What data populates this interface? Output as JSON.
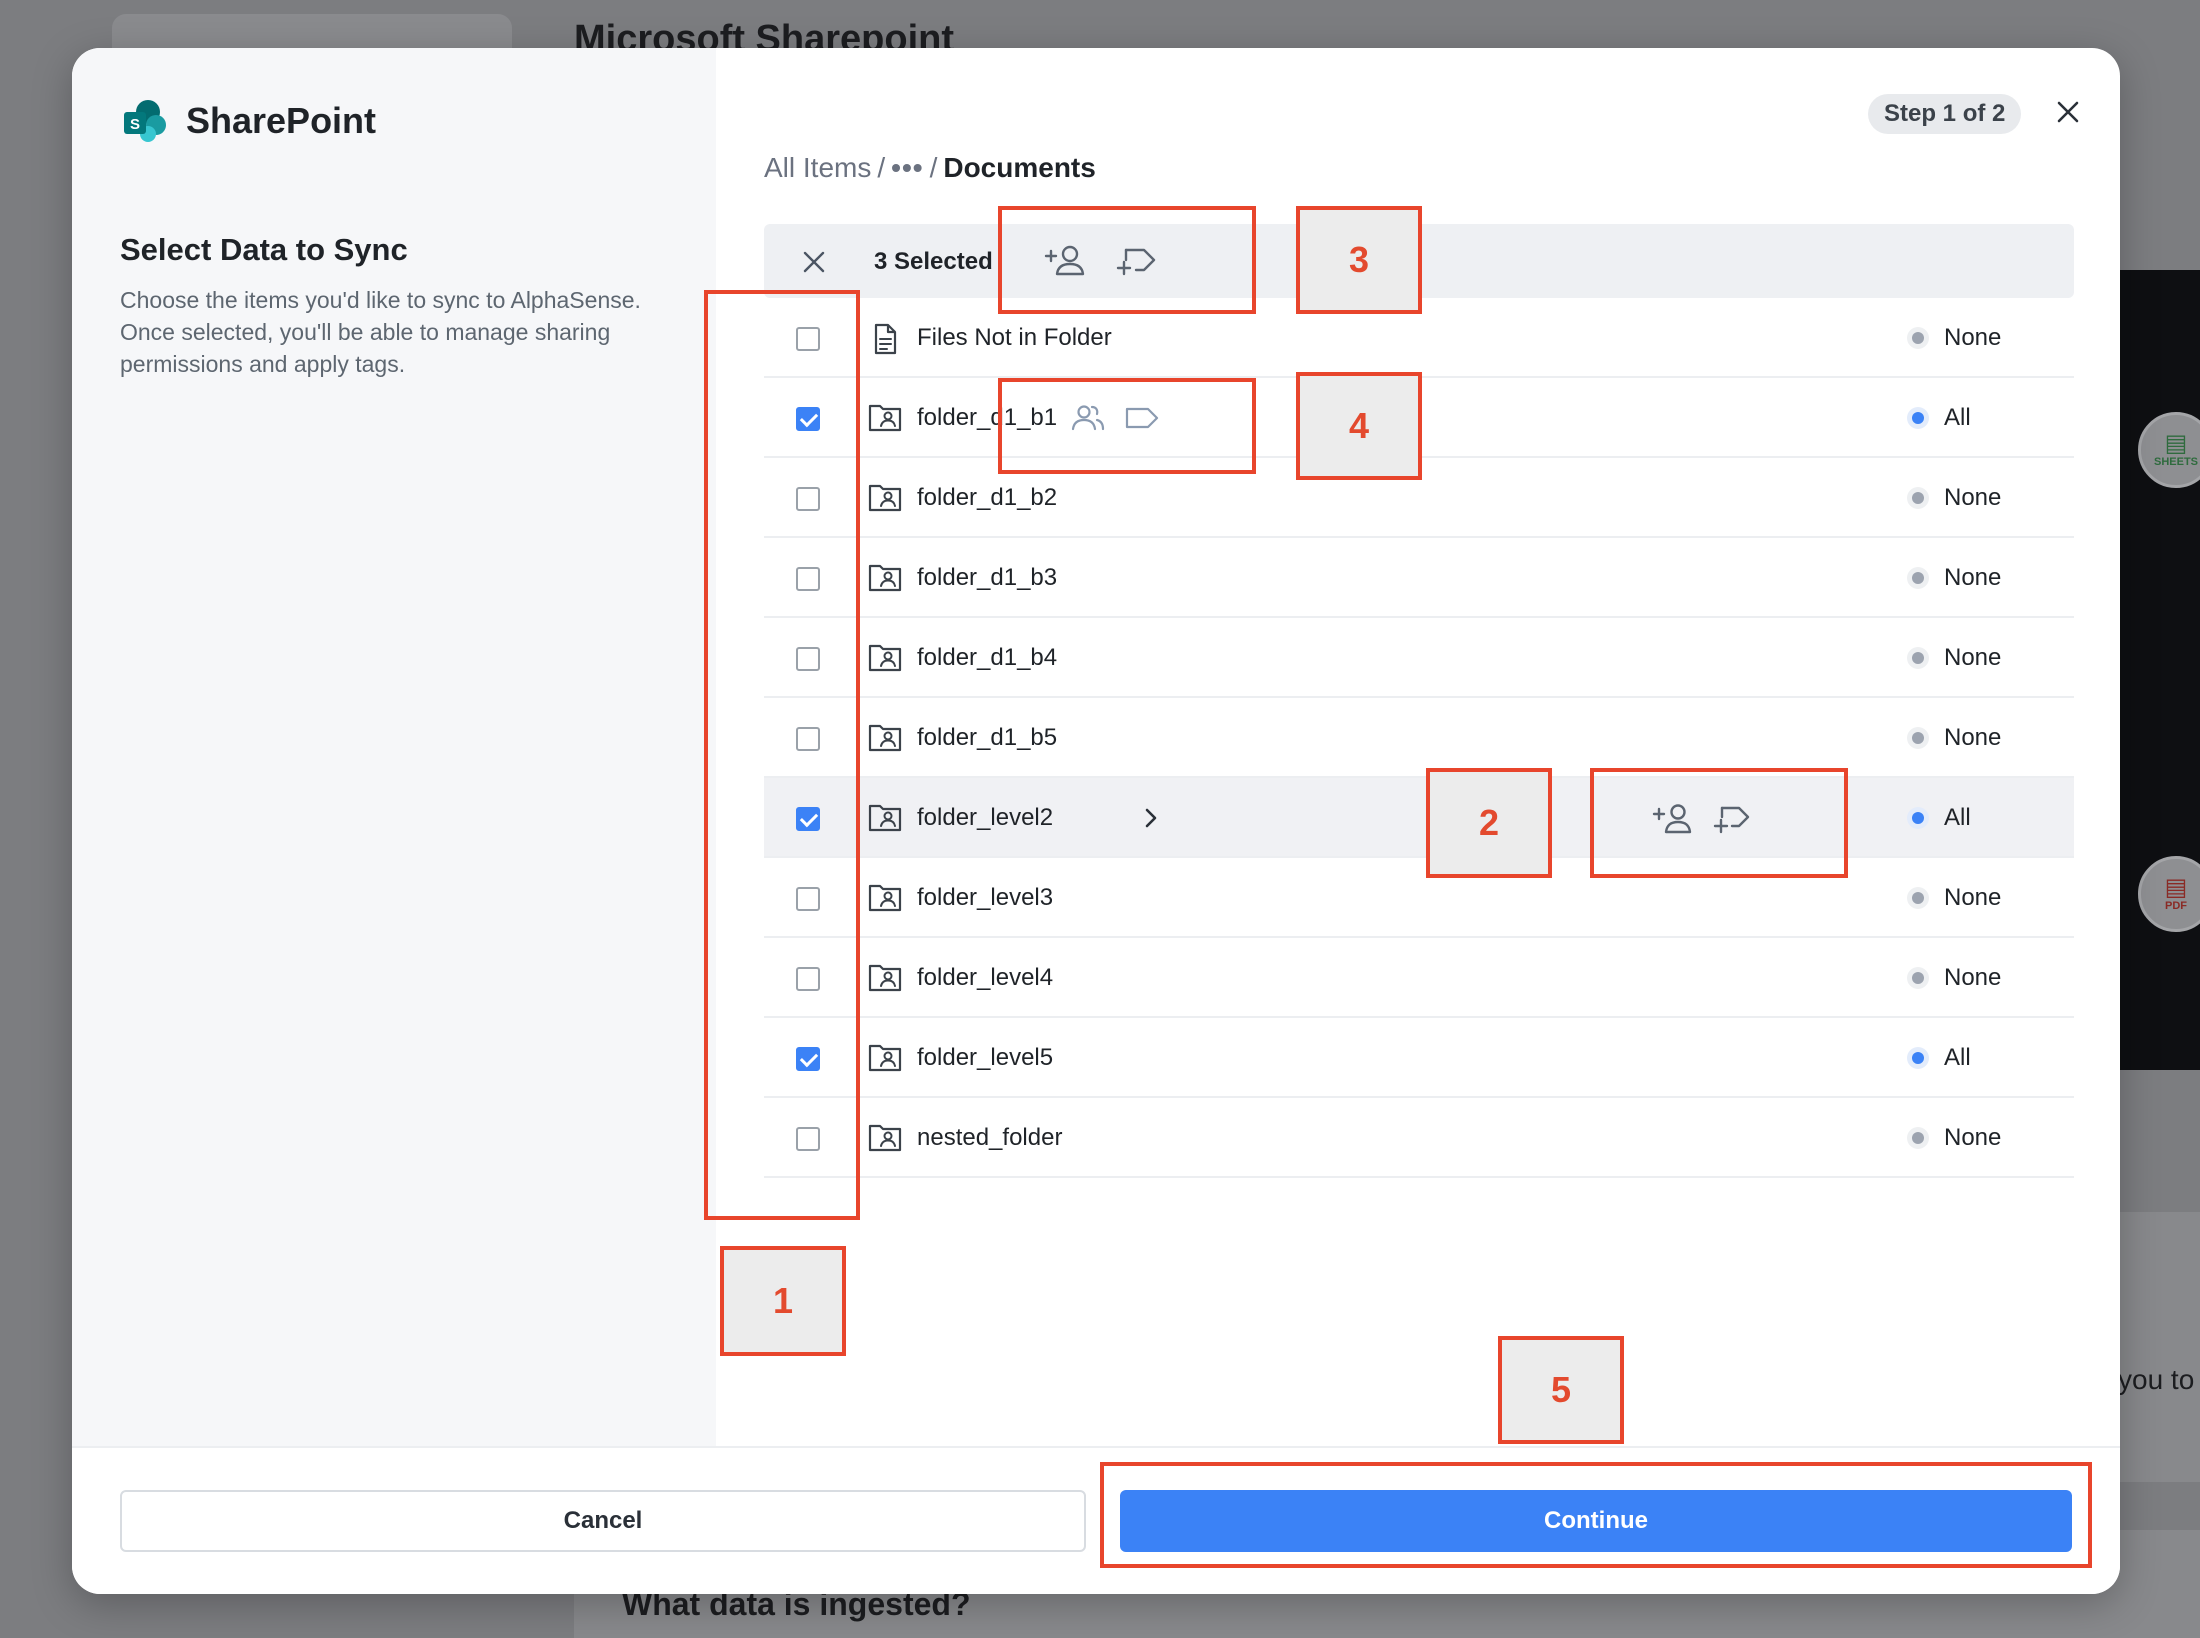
{
  "background": {
    "page_title": "Microsoft Sharepoint",
    "side_text": "you to",
    "bottom_heading": "What data is ingested?",
    "sheets_label": "SHEETS",
    "pdf_label": "PDF"
  },
  "modal": {
    "brand": {
      "name": "SharePoint",
      "icon": "sharepoint-logo"
    },
    "left": {
      "title": "Select Data to Sync",
      "description": "Choose the items you'd like to sync to AlphaSense. Once selected, you'll be able to manage sharing permissions and apply tags."
    },
    "breadcrumb": {
      "root": "All Items",
      "separator": "/",
      "ellipsis": "•••",
      "current": "Documents"
    },
    "step_badge": "Step 1 of 2",
    "selection_bar": {
      "count_label": "3 Selected",
      "icons": [
        "close-icon",
        "add-person-icon",
        "add-tag-icon"
      ]
    },
    "items": [
      {
        "name": "Files Not in Folder",
        "type": "file",
        "checked": false,
        "status": "None"
      },
      {
        "name": "folder_d1_b1",
        "type": "shared-folder",
        "checked": true,
        "status": "All",
        "has_share_icon": true,
        "has_tag_icon": true
      },
      {
        "name": "folder_d1_b2",
        "type": "shared-folder",
        "checked": false,
        "status": "None"
      },
      {
        "name": "folder_d1_b3",
        "type": "shared-folder",
        "checked": false,
        "status": "None"
      },
      {
        "name": "folder_d1_b4",
        "type": "shared-folder",
        "checked": false,
        "status": "None"
      },
      {
        "name": "folder_d1_b5",
        "type": "shared-folder",
        "checked": false,
        "status": "None"
      },
      {
        "name": "folder_level2",
        "type": "shared-folder",
        "checked": true,
        "status": "All",
        "highlighted": true,
        "expandable": true
      },
      {
        "name": "folder_level3",
        "type": "shared-folder",
        "checked": false,
        "status": "None"
      },
      {
        "name": "folder_level4",
        "type": "shared-folder",
        "checked": false,
        "status": "None"
      },
      {
        "name": "folder_level5",
        "type": "shared-folder",
        "checked": true,
        "status": "All"
      },
      {
        "name": "nested_folder",
        "type": "shared-folder",
        "checked": false,
        "status": "None"
      }
    ],
    "footer": {
      "cancel_label": "Cancel",
      "continue_label": "Continue"
    }
  },
  "annotations": [
    {
      "label": "1"
    },
    {
      "label": "2"
    },
    {
      "label": "3"
    },
    {
      "label": "4"
    },
    {
      "label": "5"
    }
  ],
  "colors": {
    "accent": "#3b82f6",
    "annotation": "#e8452c",
    "overlay": "#7c7d80",
    "left_pane": "#f6f7f9"
  }
}
